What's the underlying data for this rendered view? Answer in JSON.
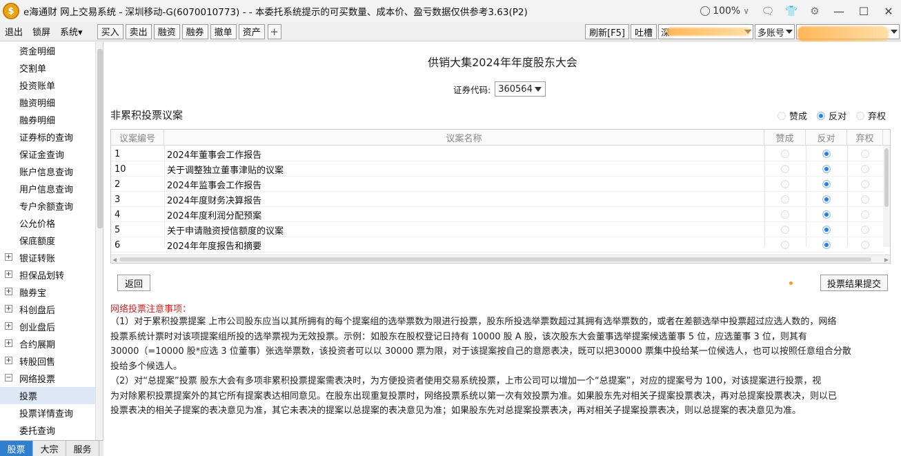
{
  "window": {
    "app_name": "e海通财 网上交易系统",
    "title": "e海通财 网上交易系统 - 深圳移动-G(6070010773) - - 本委托系统提示的可买数量、成本价、盈亏数据仅供参考3.63(P2)",
    "logo_glyph": "$",
    "zoom": "100%"
  },
  "menu": {
    "items": [
      "退出",
      "锁屏",
      "系统▾"
    ],
    "toolbar_buttons": [
      "买入",
      "卖出",
      "融资",
      "融券",
      "撤单",
      "资产"
    ],
    "plus": "+",
    "refresh": "刷新[F5]",
    "feedback": "吐槽",
    "account_prefix": "深",
    "multi_account": "多账号"
  },
  "sidebar": {
    "items": [
      {
        "label": "资金明细",
        "expandable": false
      },
      {
        "label": "交割单",
        "expandable": false
      },
      {
        "label": "投资账单",
        "expandable": false
      },
      {
        "label": "融资明细",
        "expandable": false
      },
      {
        "label": "融券明细",
        "expandable": false
      },
      {
        "label": "证券标的查询",
        "expandable": false
      },
      {
        "label": "保证金查询",
        "expandable": false
      },
      {
        "label": "账户信息查询",
        "expandable": false
      },
      {
        "label": "用户信息查询",
        "expandable": false
      },
      {
        "label": "专户余额查询",
        "expandable": false
      },
      {
        "label": "公允价格",
        "expandable": false
      },
      {
        "label": "保底额度",
        "expandable": false
      },
      {
        "label": "银证转账",
        "expandable": true,
        "marker": "+"
      },
      {
        "label": "担保品划转",
        "expandable": true,
        "marker": "+"
      },
      {
        "label": "融券宝",
        "expandable": true,
        "marker": "+"
      },
      {
        "label": "科创盘后",
        "expandable": true,
        "marker": "+"
      },
      {
        "label": "创业盘后",
        "expandable": true,
        "marker": "+"
      },
      {
        "label": "合约展期",
        "expandable": true,
        "marker": "+"
      },
      {
        "label": "转股回售",
        "expandable": true,
        "marker": "+"
      },
      {
        "label": "网络投票",
        "expandable": true,
        "marker": "−"
      },
      {
        "label": "投票",
        "expandable": false,
        "selected": true
      },
      {
        "label": "投票详情查询",
        "expandable": false
      },
      {
        "label": "委托查询",
        "expandable": false
      }
    ],
    "bottom_tabs": [
      {
        "label": "股票",
        "active": true
      },
      {
        "label": "大宗",
        "active": false
      },
      {
        "label": "服务",
        "active": false
      }
    ]
  },
  "main": {
    "meeting_title": "供销大集2024年年度股东大会",
    "security_code_label": "证券代码:",
    "security_code": "360564",
    "section_title": "非累积投票议案",
    "bulk_options": [
      {
        "label": "赞成",
        "checked": false
      },
      {
        "label": "反对",
        "checked": true
      },
      {
        "label": "弃权",
        "checked": false
      }
    ],
    "table": {
      "headers": [
        "议案编号",
        "议案名称",
        "赞成",
        "反对",
        "弃权"
      ],
      "rows": [
        {
          "id": "1",
          "name": "2024年董事会工作报告",
          "vote": "反对"
        },
        {
          "id": "10",
          "name": "关于调整独立董事津贴的议案",
          "vote": "反对"
        },
        {
          "id": "2",
          "name": "2024年监事会工作报告",
          "vote": "反对"
        },
        {
          "id": "3",
          "name": "2024年度财务决算报告",
          "vote": "反对"
        },
        {
          "id": "4",
          "name": "2024年度利润分配预案",
          "vote": "反对"
        },
        {
          "id": "5",
          "name": "关于申请融资授信额度的议案",
          "vote": "反对"
        },
        {
          "id": "6",
          "name": "2024年年度报告和摘要",
          "vote": "反对"
        }
      ]
    },
    "back_button": "返回",
    "submit_button": "投票结果提交",
    "notice_title": "网络投票注意事项：",
    "notice_lines": [
      "（1）对于累积投票提案 上市公司股东应当以其所拥有的每个提案组的选举票数为限进行投票，股东所投选举票数超过其拥有选举票数的，或者在差额选举中投票超过应选人数的，网络",
      "投票系统计票时对该项提案组所投的选举票视为无效投票。示例：如股东在股权登记日持有 10000 股 A 股，该次股东大会董事选举提案候选董事 5 位，应选董事 3 位，则其有",
      "30000（=10000 股*应选 3 位董事）张选举票数，该投资者可以以 30000 票为限，对于该提案按自己的意愿表决，既可以把30000 票集中投给某一位候选人，也可以按照任意组合分散",
      "投给多个候选人。",
      "（2）对“总提案”投票 股东大会有多项非累积投票提案需表决时，为方便投资者使用交易系统投票，上市公司可以增加一个“总提案”，对应的提案号为 100，对该提案进行投票，视",
      "为对除累积投票提案外的其它所有提案表达相同意见。在股东出现重复投票时，网络投票系统以第一次有效投票为准。如果股东先对相关子提案投票表决，再对总提案投票表决，则以已",
      "投票表决的相关子提案的表决意见为准，其它未表决的提案以总提案的表决意见为准；如果股东先对总提案投票表决，再对相关子提案投票表决，则以总提案的表决意见为准。"
    ]
  },
  "colors": {
    "accent": "#2f7fd0",
    "radio_checked": "#2c7de0",
    "notice_title": "#d02020",
    "logo": "#e8a317",
    "redaction": "#f5b060"
  }
}
